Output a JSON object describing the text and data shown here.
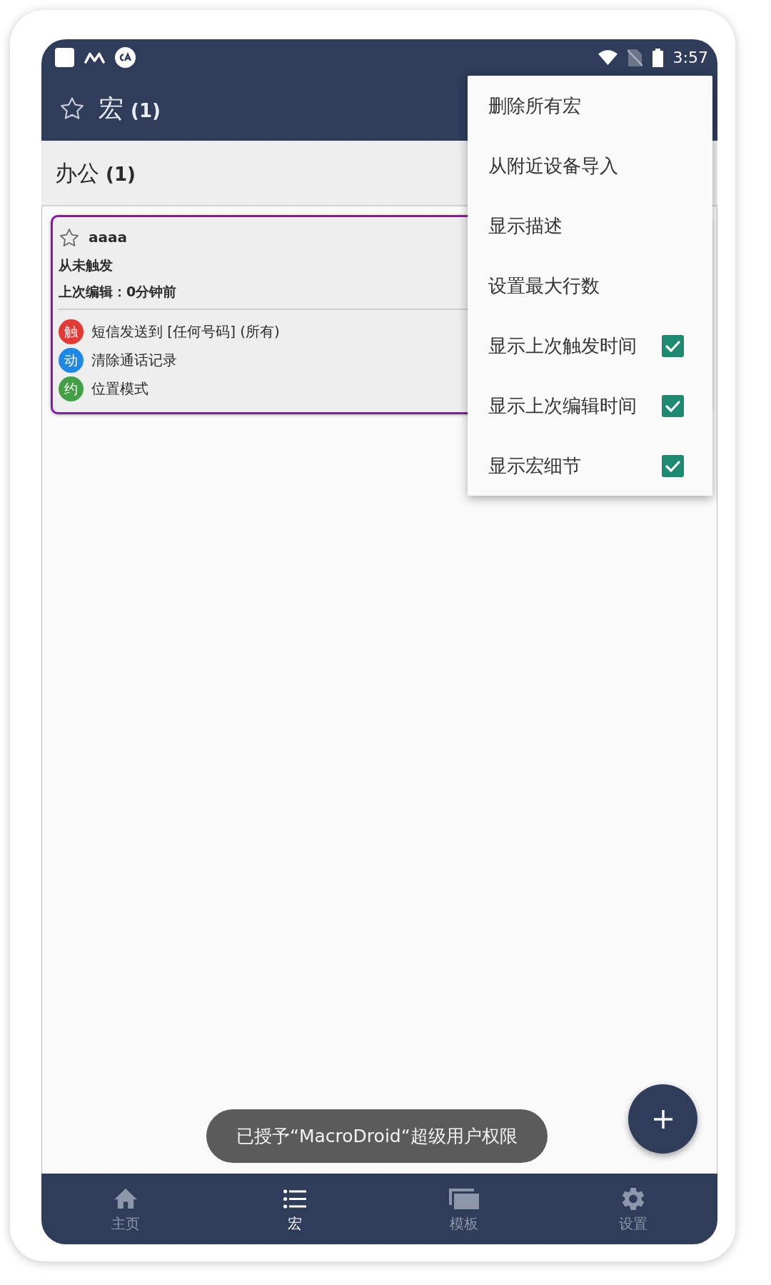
{
  "status_bar": {
    "time": "3:57"
  },
  "app_bar": {
    "title": "宏",
    "count": "(1)"
  },
  "category": {
    "name": "办公",
    "count": "(1)"
  },
  "macros": [
    {
      "name": "aaaa",
      "favorite": false,
      "last_triggered": "从未触发",
      "last_edited": "上次编辑：0分钟前",
      "entries": [
        {
          "badge": "触",
          "text": "短信发送到 [任何号码] (所有)",
          "color": "#e53935"
        },
        {
          "badge": "动",
          "text": "清除通话记录",
          "color": "#1e88e5"
        },
        {
          "badge": "约",
          "text": "位置模式",
          "color": "#43a047"
        }
      ]
    }
  ],
  "menu": [
    {
      "label": "删除所有宏",
      "kind": "action"
    },
    {
      "label": "从附近设备导入",
      "kind": "action"
    },
    {
      "label": "显示描述",
      "kind": "action"
    },
    {
      "label": "设置最大行数",
      "kind": "action"
    },
    {
      "label": "显示上次触发时间",
      "kind": "checkbox",
      "checked": true
    },
    {
      "label": "显示上次编辑时间",
      "kind": "checkbox",
      "checked": true
    },
    {
      "label": "显示宏细节",
      "kind": "checkbox",
      "checked": true
    }
  ],
  "toast": "已授予“MacroDroid“超级用户权限",
  "bottom_nav": [
    {
      "label": "主页",
      "selected": false
    },
    {
      "label": "宏",
      "selected": true
    },
    {
      "label": "模板",
      "selected": false
    },
    {
      "label": "设置",
      "selected": false
    }
  ]
}
